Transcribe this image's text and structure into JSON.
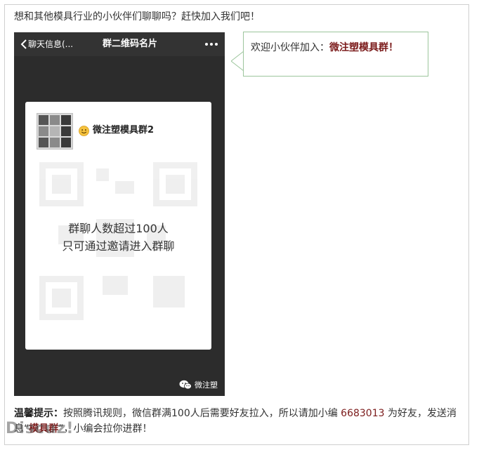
{
  "intro_text": "想和其他模具行业的小伙伴们聊聊吗？赶快加入我们吧！",
  "phone": {
    "back_label": "聊天信息(...",
    "title": "群二维码名片",
    "group_name": "微注塑模具群2",
    "qr_message_line1": "群聊人数超过100人",
    "qr_message_line2": "只可通过邀请进入群聊",
    "footer_label": "微注塑",
    "icons": [
      "chevron-left-icon",
      "more-dots-icon",
      "smiley-icon",
      "wechat-icon"
    ]
  },
  "bubble": {
    "prefix": "欢迎小伙伴加入：",
    "emphasis": "微注塑模具群！"
  },
  "tips": {
    "label": "温馨提示：",
    "text_before_number": "按照腾讯规则，微信群满100人后需要好友拉入，所以请加小编 ",
    "number": "6683013",
    "text_after_number": " 为好友，发送消息“",
    "group_word": "模具群",
    "text_end": "”，小编会拉你进群！"
  },
  "watermark": "Discuz!",
  "colors": {
    "accent": "#7b1b1b",
    "bubble_border": "#9cc59c",
    "phone_bg": "#2c2c2c"
  }
}
